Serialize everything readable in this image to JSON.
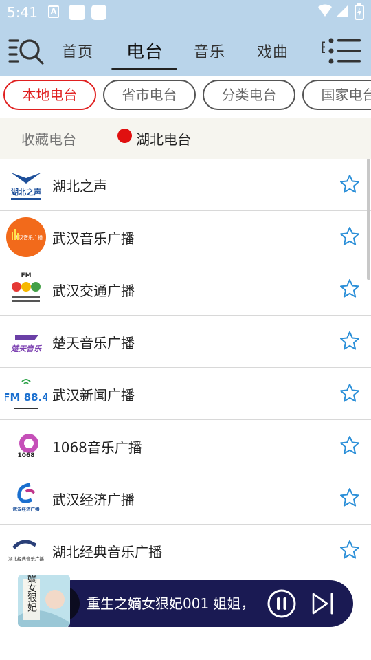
{
  "status_bar": {
    "time": "5:41",
    "a_icon": "A"
  },
  "header": {
    "tabs": [
      {
        "label": "首页"
      },
      {
        "label": "电台",
        "active": true
      },
      {
        "label": "音乐"
      },
      {
        "label": "戏曲"
      },
      {
        "label": "E"
      }
    ]
  },
  "chips": [
    {
      "label": "本地电台",
      "active": true
    },
    {
      "label": "省市电台"
    },
    {
      "label": "分类电台"
    },
    {
      "label": "国家电台"
    }
  ],
  "subtabs": [
    {
      "label": "收藏电台"
    },
    {
      "label": "湖北电台",
      "active": true
    }
  ],
  "stations": [
    {
      "name": "湖北之声",
      "logo_text": "湖北之声"
    },
    {
      "name": "武汉音乐广播",
      "logo_text": "武汉音乐广播"
    },
    {
      "name": "武汉交通广播",
      "logo_text": "FM"
    },
    {
      "name": "楚天音乐广播",
      "logo_text": "楚天音乐"
    },
    {
      "name": "武汉新闻广播",
      "logo_text": "FM 88.4"
    },
    {
      "name": "1068音乐广播",
      "logo_text": "1068"
    },
    {
      "name": "武汉经济广播",
      "logo_text": "武汉经济广播"
    },
    {
      "name": "湖北经典音乐广播",
      "logo_text": "湖北经典音乐广播"
    }
  ],
  "player": {
    "now_playing": "重生之嫡女狠妃001 姐姐，",
    "cover_text": "嫡女狠妃"
  },
  "colors": {
    "header_bg": "#b9d4ea",
    "chip_active": "#e02020",
    "star": "#2b8fd8",
    "player_bg": "#1a1a53"
  }
}
